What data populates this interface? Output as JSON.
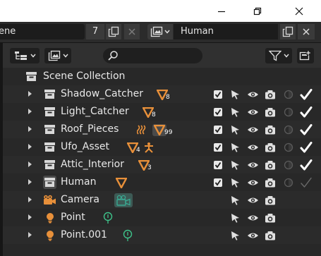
{
  "window": {
    "minimize_icon": "minimize-icon",
    "maximize_icon": "restore-icon",
    "close_icon": "close-icon"
  },
  "header": {
    "scene_name": "ene",
    "scene_users": "7",
    "view_layer_name": "Human"
  },
  "outliner": {
    "display_mode_icon": "display-mode-icon",
    "filter_icon": "funnel-icon",
    "new_collection_icon": "new-collection-icon",
    "search_placeholder": ""
  },
  "tree": {
    "scene_collection": "Scene Collection",
    "rows": [
      {
        "label": "Shadow_Catcher",
        "type": "collection",
        "badge": "8"
      },
      {
        "label": "Light_Catcher",
        "type": "collection",
        "badge": "8"
      },
      {
        "label": "Roof_Pieces",
        "type": "collection",
        "badge": "99"
      },
      {
        "label": "Ufo_Asset",
        "type": "collection",
        "badge": "4"
      },
      {
        "label": "Attic_Interior",
        "type": "collection",
        "badge": "3"
      },
      {
        "label": "Human",
        "type": "collection",
        "badge": ""
      },
      {
        "label": "Camera",
        "type": "camera",
        "badge": ""
      },
      {
        "label": "Point",
        "type": "light",
        "badge": ""
      },
      {
        "label": "Point.001",
        "type": "light",
        "badge": ""
      }
    ]
  },
  "colors": {
    "accent_orange": "#e8903a",
    "camera_green": "#3aa891",
    "light_orange": "#e8903a",
    "light_green": "#3ec28a"
  }
}
